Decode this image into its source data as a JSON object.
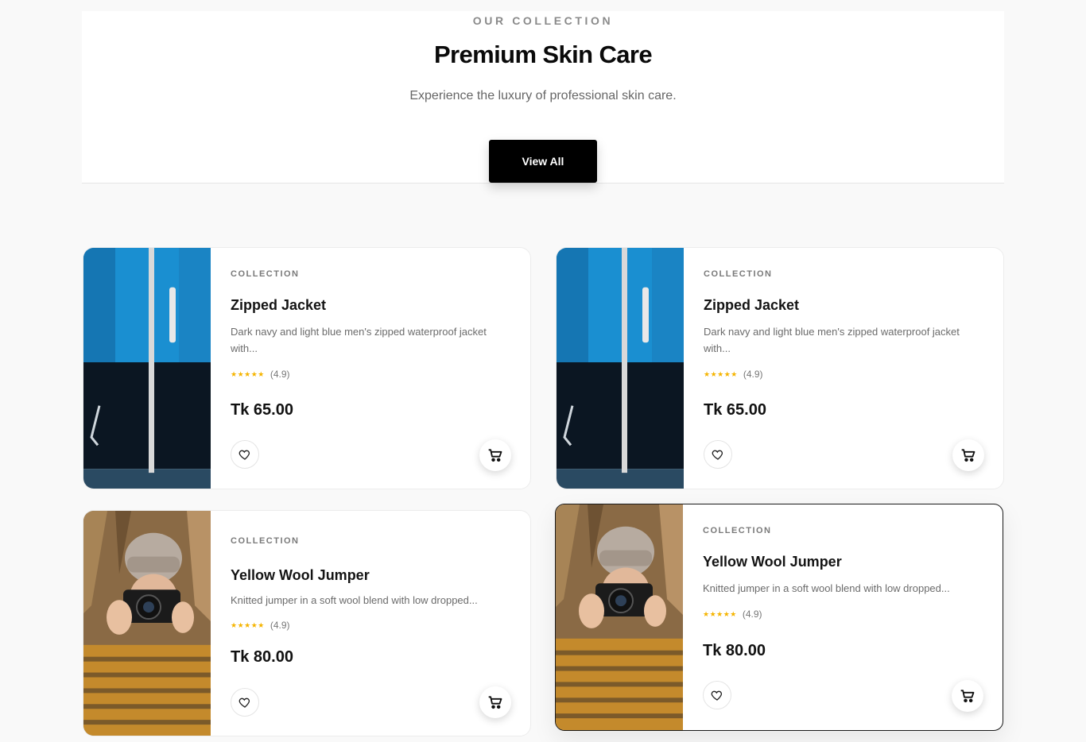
{
  "hero": {
    "eyebrow": "OUR COLLECTION",
    "title": "Premium Skin Care",
    "subtitle": "Experience the luxury of professional skin care.",
    "button_label": "View All"
  },
  "products": [
    {
      "category": "COLLECTION",
      "name": "Zipped Jacket",
      "description": "Dark navy and light blue men's zipped waterproof jacket with...",
      "stars": "★★★★★",
      "rating": "(4.9)",
      "price": "Tk 65.00",
      "image": "blue-jacket-photo"
    },
    {
      "category": "COLLECTION",
      "name": "Zipped Jacket",
      "description": "Dark navy and light blue men's zipped waterproof jacket with...",
      "stars": "★★★★★",
      "rating": "(4.9)",
      "price": "Tk 65.00",
      "image": "blue-jacket-photo"
    },
    {
      "category": "COLLECTION",
      "name": "Yellow Wool Jumper",
      "description": "Knitted jumper in a soft wool blend with low dropped...",
      "stars": "★★★★★",
      "rating": "(4.9)",
      "price": "Tk 80.00",
      "image": "wool-jumper-photo"
    },
    {
      "category": "COLLECTION",
      "name": "Yellow Wool Jumper",
      "description": "Knitted jumper in a soft wool blend with low dropped...",
      "stars": "★★★★★",
      "rating": "(4.9)",
      "price": "Tk 80.00",
      "image": "wool-jumper-photo"
    }
  ],
  "icons": {
    "wishlist": "heart-icon",
    "cart": "shopping-cart-icon"
  },
  "colors": {
    "accent": "#000000",
    "star": "#f5b400",
    "background": "#f9f9f9"
  }
}
